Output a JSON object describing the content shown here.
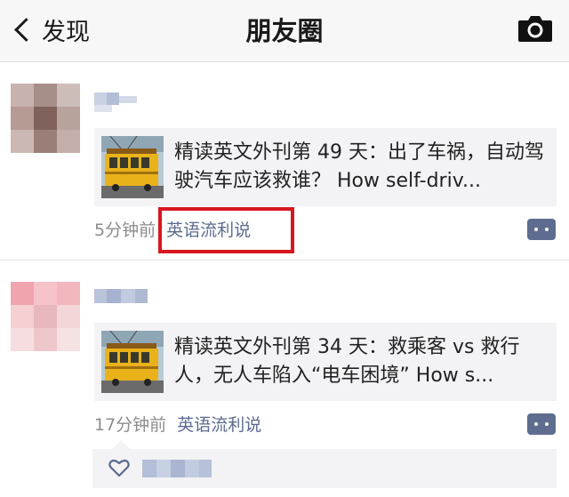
{
  "navbar": {
    "back_label": "发现",
    "title": "朋友圈"
  },
  "posts": [
    {
      "title": "精读英文外刊第 49 天：出了车祸，自动驾驶汽车应该救谁？ How self-driv...",
      "time": "5分钟前",
      "source": "英语流利说"
    },
    {
      "title": "精读英文外刊第 34 天：救乘客 vs 救行人，无人车陷入“电车困境” How s...",
      "time": "17分钟前",
      "source": "英语流利说"
    }
  ],
  "colors": {
    "highlight": "#d8161f",
    "link": "#5b6a91",
    "accent_icon": "#5e6d8f"
  }
}
